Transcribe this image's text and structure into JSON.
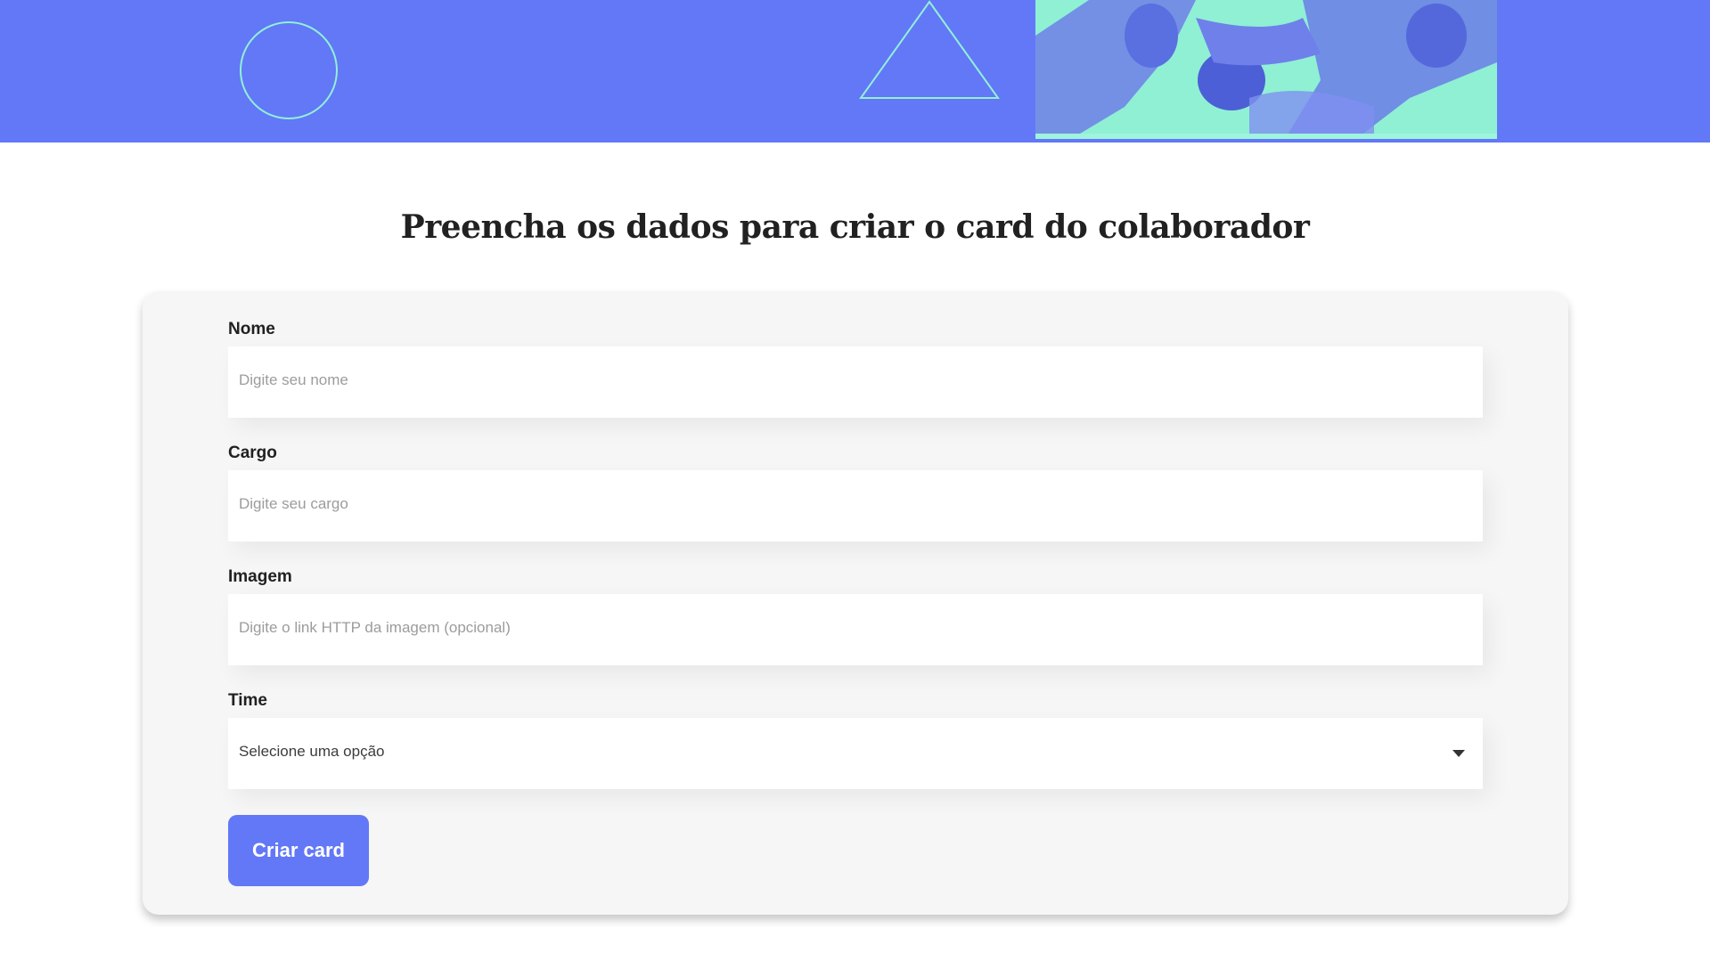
{
  "banner": {
    "background_color": "#6278f7",
    "accent_color": "#91f0d6",
    "photo_tint": "#8ff0d4"
  },
  "form": {
    "title": "Preencha os dados para criar o card do colaborador",
    "fields": [
      {
        "label": "Nome",
        "placeholder": "Digite seu nome",
        "value": ""
      },
      {
        "label": "Cargo",
        "placeholder": "Digite seu cargo",
        "value": ""
      },
      {
        "label": "Imagem",
        "placeholder": "Digite o link HTTP da imagem (opcional)",
        "value": ""
      }
    ],
    "select": {
      "label": "Time",
      "selected": "Selecione uma opção"
    },
    "submit_label": "Criar card",
    "submit_color": "#6278f7"
  }
}
